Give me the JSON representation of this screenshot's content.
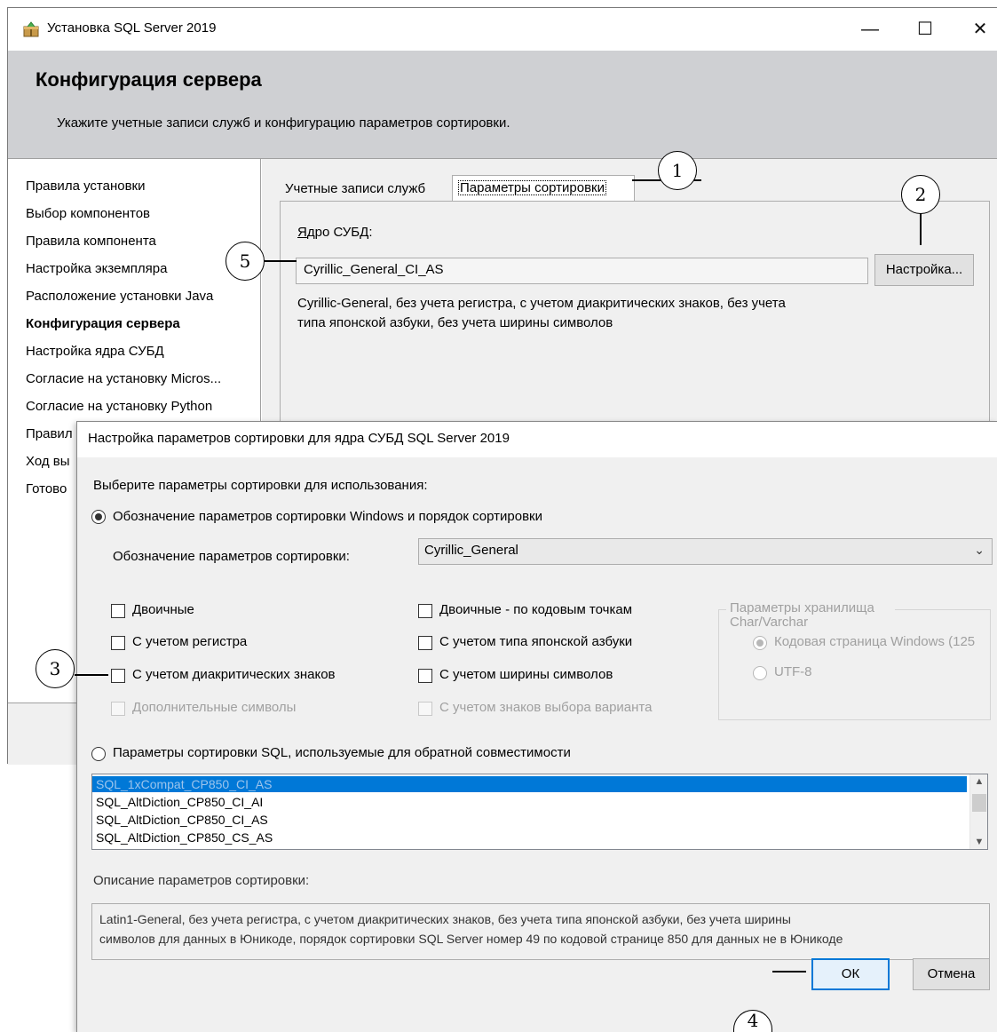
{
  "main_window": {
    "title": "Установка SQL Server 2019",
    "controls": {
      "minimize": "—",
      "maximize": "☐",
      "close": "✕"
    },
    "header": {
      "title": "Конфигурация сервера",
      "subtitle": "Укажите учетные записи служб и конфигурацию параметров сортировки."
    },
    "sidebar": {
      "items": [
        {
          "label": "Правила установки",
          "active": false
        },
        {
          "label": "Выбор компонентов",
          "active": false
        },
        {
          "label": "Правила компонента",
          "active": false
        },
        {
          "label": "Настройка экземпляра",
          "active": false
        },
        {
          "label": "Расположение установки Java",
          "active": false
        },
        {
          "label": "Конфигурация сервера",
          "active": true
        },
        {
          "label": "Настройка ядра СУБД",
          "active": false
        },
        {
          "label": "Согласие на установку Micros...",
          "active": false
        },
        {
          "label": "Согласие на установку Python",
          "active": false
        },
        {
          "label": "Правил",
          "active": false
        },
        {
          "label": "Ход вы",
          "active": false
        },
        {
          "label": "Готово",
          "active": false
        }
      ]
    },
    "tabs": [
      {
        "label": "Учетные записи служб",
        "selected": false
      },
      {
        "label": "Параметры сортировки",
        "selected": true
      }
    ],
    "collation_tab": {
      "db_engine_label": "Ядро СУБД:",
      "db_engine_mnemonic": "Я",
      "db_engine_rest": "дро СУБД:",
      "collation_value": "Cyrillic_General_CI_AS",
      "customize_label": "Настройка...",
      "description_line1": "Cyrillic-General, без учета регистра, с учетом диакритических знаков, без учета",
      "description_line2": "типа японской азбуки, без учета ширины символов"
    }
  },
  "dialog": {
    "title": "Настройка параметров сортировки для ядра СУБД SQL Server 2019",
    "choose_label": "Выберите параметры сортировки для использования:",
    "windows_option": {
      "label": "Обозначение параметров сортировки Windows и порядок сортировки",
      "checked": true
    },
    "designator": {
      "label": "Обозначение параметров сортировки:",
      "selected_value": "Cyrillic_General"
    },
    "checkboxes_left": [
      {
        "label": "Двоичные",
        "checked": false,
        "enabled": true
      },
      {
        "label": "С учетом регистра",
        "checked": false,
        "enabled": true
      },
      {
        "label": "С учетом диакритических знаков",
        "checked": false,
        "enabled": true
      },
      {
        "label": "Дополнительные символы",
        "checked": false,
        "enabled": false
      }
    ],
    "checkboxes_right": [
      {
        "label": "Двоичные - по кодовым точкам",
        "checked": false,
        "enabled": true
      },
      {
        "label": "С учетом типа японской азбуки",
        "checked": false,
        "enabled": true
      },
      {
        "label": "С учетом ширины символов",
        "checked": false,
        "enabled": true
      },
      {
        "label": "С учетом знаков выбора варианта",
        "checked": false,
        "enabled": false
      }
    ],
    "storage_group": {
      "legend": "Параметры хранилища Char/Varchar",
      "options": [
        {
          "label": "Кодовая страница Windows (125",
          "checked": true,
          "enabled": false
        },
        {
          "label": "UTF-8",
          "checked": false,
          "enabled": false
        }
      ]
    },
    "sql_option": {
      "label": "Параметры сортировки SQL, используемые для обратной совместимости",
      "checked": false
    },
    "sql_collations": [
      {
        "name": "SQL_1xCompat_CP850_CI_AS",
        "selected": true
      },
      {
        "name": "SQL_AltDiction_CP850_CI_AI",
        "selected": false
      },
      {
        "name": "SQL_AltDiction_CP850_CI_AS",
        "selected": false
      },
      {
        "name": "SQL_AltDiction_CP850_CS_AS",
        "selected": false
      }
    ],
    "description_label": "Описание параметров сортировки:",
    "description_line1": "Latin1-General, без учета регистра, с учетом диакритических знаков, без учета типа японской азбуки, без учета ширины",
    "description_line2": "символов для данных в Юникоде, порядок сортировки SQL Server номер 49 по кодовой странице 850 для данных не в Юникоде",
    "ok_label": "ОК",
    "cancel_label": "Отмена"
  },
  "callouts": [
    "1",
    "2",
    "3",
    "4",
    "5"
  ],
  "colors": {
    "header_bg": "#cfd0d3",
    "selection_blue": "#0078d7",
    "dialog_bg": "#f0f0f0"
  }
}
